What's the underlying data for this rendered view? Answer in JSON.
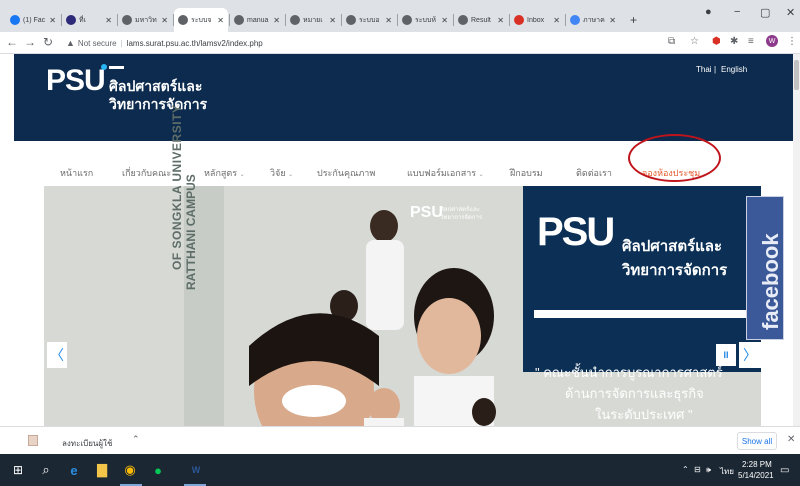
{
  "browser": {
    "tabs": [
      {
        "title": "(1) Fac",
        "favicon": "facebook-icon",
        "color": "#1877f2"
      },
      {
        "title": "ที่เ",
        "favicon": "thai-flag-icon",
        "color": "#2d2a7a"
      },
      {
        "title": "มหาวิท",
        "favicon": "globe-icon",
        "color": "#5f6368"
      },
      {
        "title": "ระบบจ",
        "favicon": "globe-icon",
        "color": "#5f6368"
      },
      {
        "title": "manua",
        "favicon": "globe-icon",
        "color": "#5f6368"
      },
      {
        "title": "หมายเ",
        "favicon": "globe-icon",
        "color": "#5f6368"
      },
      {
        "title": "ระบบอ",
        "favicon": "globe-icon",
        "color": "#5f6368"
      },
      {
        "title": "ระบบห้",
        "favicon": "globe-icon",
        "color": "#5f6368"
      },
      {
        "title": "Result",
        "favicon": "globe-icon",
        "color": "#5f6368"
      },
      {
        "title": "Inbox",
        "favicon": "gmail-icon",
        "color": "#d93025"
      },
      {
        "title": "ภาษาค",
        "favicon": "google-icon",
        "color": "#4285f4"
      }
    ],
    "active_tab_index": 3,
    "new_tab_symbol": "+",
    "url_security": "Not secure",
    "url": "lams.surat.psu.ac.th/lamsv2/index.php"
  },
  "site": {
    "logo_text": "PSU",
    "faculty_line1": "ศิลปศาสตร์และ",
    "faculty_line2": "วิทยาการจัดการ",
    "lang_thai": "Thai",
    "lang_sep": "|",
    "lang_english": "English",
    "menu": [
      {
        "label": "หน้าแรก",
        "caret": false,
        "highlight": false
      },
      {
        "label": "เกี่ยวกับคณะ",
        "caret": true,
        "highlight": false
      },
      {
        "label": "หลักสูตร",
        "caret": true,
        "highlight": false
      },
      {
        "label": "วิจัย",
        "caret": true,
        "highlight": false
      },
      {
        "label": "ประกันคุณภาพ",
        "caret": false,
        "highlight": false
      },
      {
        "label": "แบบฟอร์มเอกสาร",
        "caret": true,
        "highlight": false
      },
      {
        "label": "ฝึกอบรม",
        "caret": false,
        "highlight": false
      },
      {
        "label": "ติดต่อเรา",
        "caret": false,
        "highlight": false
      },
      {
        "label": "จองห้องประชุม",
        "caret": false,
        "highlight": true
      }
    ],
    "banner": {
      "vertical_text_1": "OF SONGKLA UNIVERSITY",
      "vertical_text_2": "RATTHANI CAMPUS",
      "small_logo": "PSU",
      "small_faculty_1": "ศิลปศาสตร์และ",
      "small_faculty_2": "วิทยาการจัดการ",
      "big_logo": "PSU",
      "big_faculty_1": "ศิลปศาสตร์และ",
      "big_faculty_2": "วิทยาการจัดการ",
      "quote_1": "\" คณะชั้นนำการบูรณาการศาสตร์",
      "quote_2": "ด้านการจัดการและธุรกิจ",
      "quote_3": "ในระดับประเทศ \"",
      "facebook_label": "facebook",
      "prev_symbol": "〈",
      "next_symbol": "〉",
      "pause_symbol": "II"
    },
    "accent_color": "#e55b2d",
    "header_color": "#0c2b4e"
  },
  "downloads": {
    "file_name": "ลงทะเบียนผู้ใช้",
    "show_all": "Show all"
  },
  "taskbar": {
    "time": "2:28 PM",
    "date": "5/14/2021",
    "ime": "ไทย"
  }
}
